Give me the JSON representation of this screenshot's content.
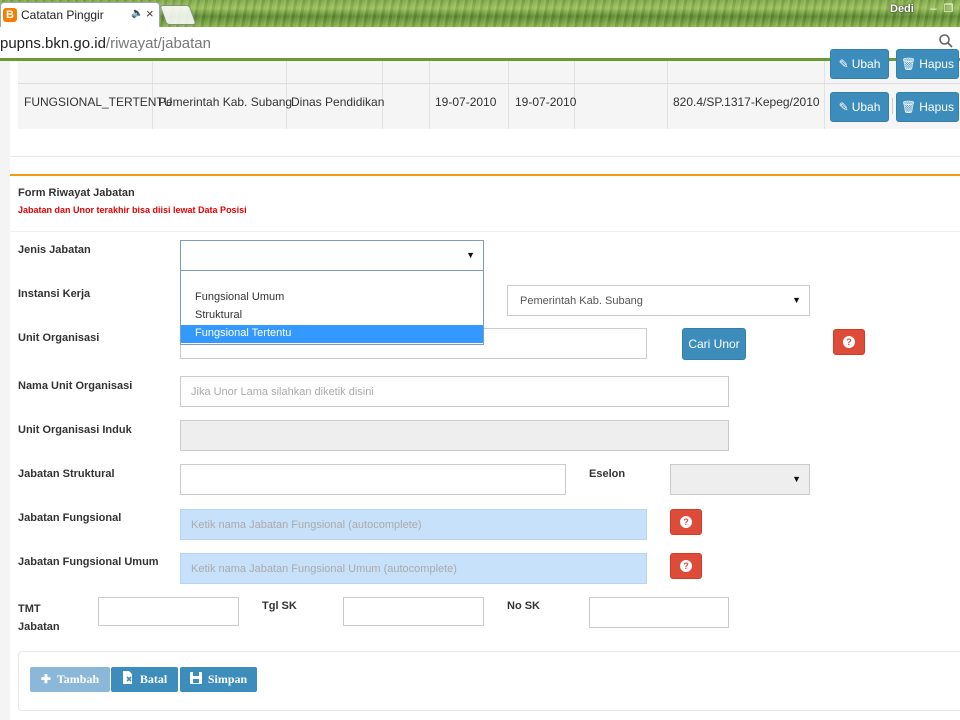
{
  "browser": {
    "tab_title": "Catatan Pinggir",
    "user_name": "Dedi",
    "url_host": "pupns.bkn.go.id",
    "url_path": "/riwayat/jabatan"
  },
  "table": {
    "partial_row": {
      "edit_label": "Ubah",
      "delete_label": "Hapus"
    },
    "row": {
      "jenis": "FUNGSIONAL_TERTENTU",
      "instansi": "Pemerintah Kab. Subang",
      "unor": "Dinas Pendidikan",
      "tmt": "19-07-2010",
      "tgl_sk": "19-07-2010",
      "no_sk": "820.4/SP.1317-Kepeg/2010",
      "edit_label": "Ubah",
      "delete_label": "Hapus"
    }
  },
  "form": {
    "title": "Form Riwayat Jabatan",
    "note": "Jabatan dan Unor terakhir bisa diisi lewat Data Posisi",
    "labels": {
      "jenis_jabatan": "Jenis Jabatan",
      "instansi_kerja": "Instansi Kerja",
      "unit_organisasi": "Unit Organisasi",
      "nama_unit_organisasi": "Nama Unit Organisasi",
      "unit_organisasi_induk": "Unit Organisasi Induk",
      "jabatan_struktural": "Jabatan Struktural",
      "eselon": "Eselon",
      "jabatan_fungsional": "Jabatan Fungsional",
      "jabatan_fungsional_umum": "Jabatan Fungsional Umum",
      "tmt_line1": "TMT",
      "tmt_line2": "Jabatan",
      "tgl_sk": "Tgl SK",
      "no_sk": "No SK"
    },
    "jenis_jabatan_value": "",
    "jenis_jabatan_options": [
      "Fungsional Umum",
      "Struktural",
      "Fungsional Tertentu"
    ],
    "instansi_kerja_value": "Pemerintah Kab. Subang",
    "cari_unor_label": "Cari Unor",
    "nama_unit_placeholder": "Jika Unor Lama silahkan diketik disini",
    "jabatan_fungsional_placeholder": "Ketik nama Jabatan Fungsional (autocomplete)",
    "jabatan_fungsional_umum_placeholder": "Ketik nama Jabatan Fungsional Umum (autocomplete)",
    "help_glyph": "?"
  },
  "footer": {
    "tambah_label": "Tambah",
    "batal_label": "Batal",
    "simpan_label": "Simpan"
  },
  "colors": {
    "primary": "#3c8dbc",
    "danger": "#dd4b39",
    "warning_line": "#f39c12",
    "selected_option": "#3399ff"
  }
}
